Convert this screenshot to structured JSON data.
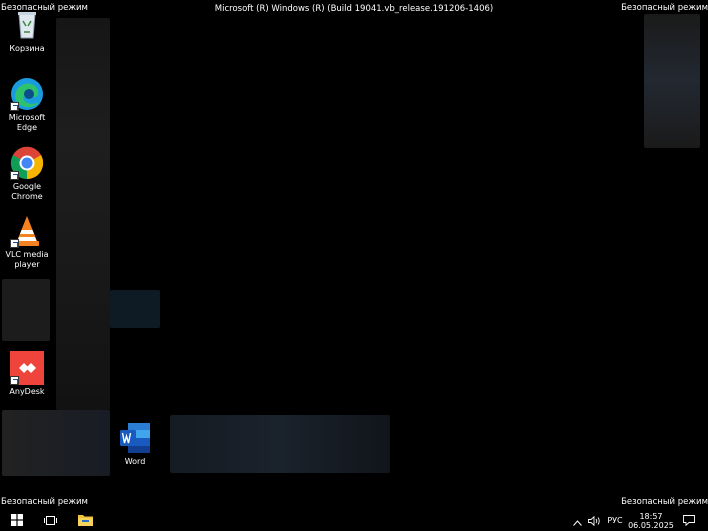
{
  "window": {
    "safe_mode_label": "Безопасный режим",
    "build_text": "Microsoft (R) Windows (R) (Build 19041.vb_release.191206-1406)"
  },
  "desktop_icons": [
    {
      "label": "Корзина",
      "icon": "recycle-bin-icon"
    },
    {
      "label": "Microsoft Edge",
      "icon": "edge-icon"
    },
    {
      "label": "Google Chrome",
      "icon": "chrome-icon"
    },
    {
      "label": "VLC media player",
      "icon": "vlc-icon"
    },
    {
      "label": "AnyDesk",
      "icon": "anydesk-icon"
    },
    {
      "label": "Word",
      "icon": "word-icon"
    }
  ],
  "taskbar": {
    "start_icon": "windows-logo-icon",
    "task_view_icon": "task-view-icon",
    "explorer_icon": "file-explorer-icon",
    "tray": {
      "chevron_icon": "chevron-up-icon",
      "volume_icon": "volume-icon",
      "language": "РУС",
      "time": "18:57",
      "date": "06.05.2025",
      "notifications_icon": "notification-icon"
    }
  },
  "colors": {
    "background": "#000000",
    "text": "#ffffff"
  }
}
